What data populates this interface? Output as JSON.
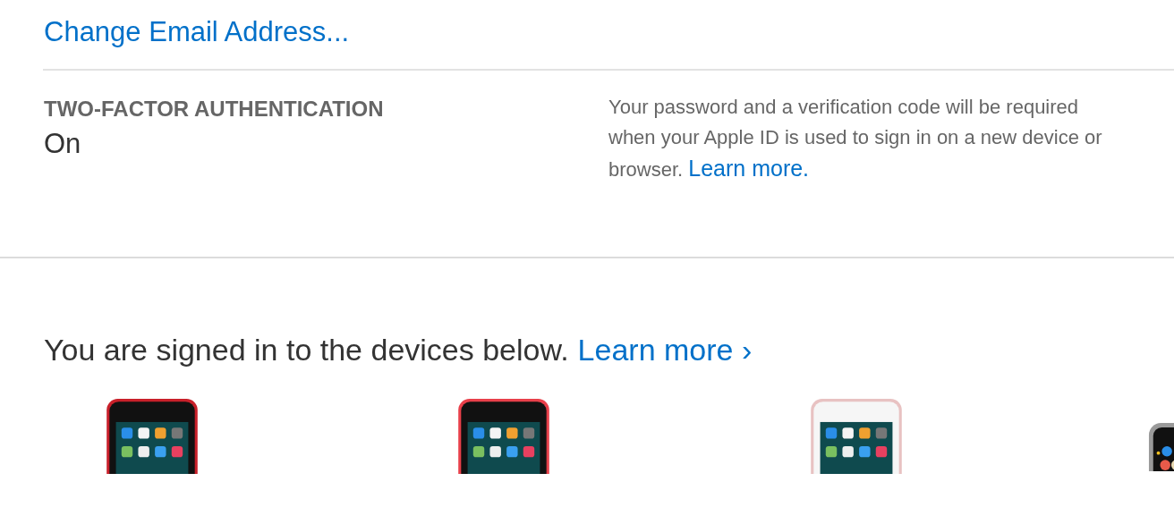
{
  "email_link": "Change Email Address...",
  "two_factor": {
    "heading": "TWO-FACTOR AUTHENTICATION",
    "status": "On",
    "description": "Your password and a verification code will be required when your Apple ID is used to sign in on a new device or browser.",
    "link": "Learn more."
  },
  "devices_section": {
    "intro": "You are signed in to the devices below.",
    "link": "Learn more",
    "link_chevron": "›"
  }
}
